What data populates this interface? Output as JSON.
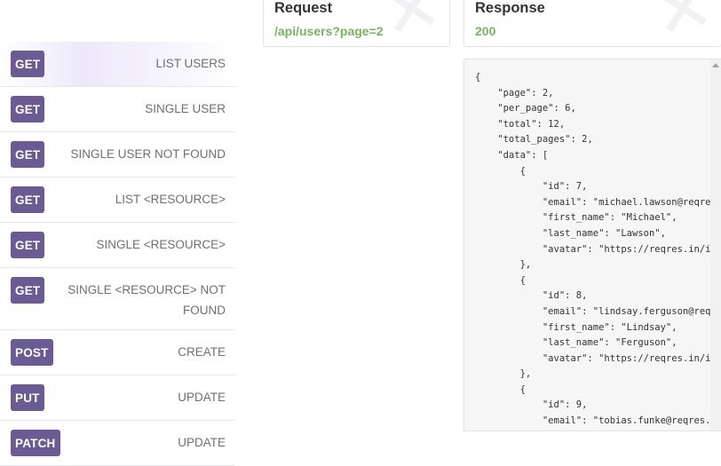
{
  "endpoints": [
    {
      "method": "GET",
      "label": "LIST USERS",
      "active": true
    },
    {
      "method": "GET",
      "label": "SINGLE USER"
    },
    {
      "method": "GET",
      "label": "SINGLE USER NOT FOUND"
    },
    {
      "method": "GET",
      "label": "LIST <RESOURCE>"
    },
    {
      "method": "GET",
      "label": "SINGLE <RESOURCE>"
    },
    {
      "method": "GET",
      "label": "SINGLE <RESOURCE> NOT FOUND"
    },
    {
      "method": "POST",
      "label": "CREATE"
    },
    {
      "method": "PUT",
      "label": "UPDATE"
    },
    {
      "method": "PATCH",
      "label": "UPDATE"
    }
  ],
  "request": {
    "title": "Request",
    "url": "/api/users?page=2"
  },
  "response": {
    "title": "Response",
    "status": "200"
  },
  "output_lines": [
    "{",
    "    \"page\": 2,",
    "    \"per_page\": 6,",
    "    \"total\": 12,",
    "    \"total_pages\": 2,",
    "    \"data\": [",
    "        {",
    "            \"id\": 7,",
    "            \"email\": \"michael.lawson@reqres.",
    "            \"first_name\": \"Michael\",",
    "            \"last_name\": \"Lawson\",",
    "            \"avatar\": \"https://reqres.in/img",
    "        },",
    "        {",
    "            \"id\": 8,",
    "            \"email\": \"lindsay.ferguson@reqre",
    "            \"first_name\": \"Lindsay\",",
    "            \"last_name\": \"Ferguson\",",
    "            \"avatar\": \"https://reqres.in/img",
    "        },",
    "        {",
    "            \"id\": 9,",
    "            \"email\": \"tobias.funke@reqres.in"
  ],
  "colors": {
    "method_bg": "#6b5b95",
    "status_green": "#74b65e"
  }
}
